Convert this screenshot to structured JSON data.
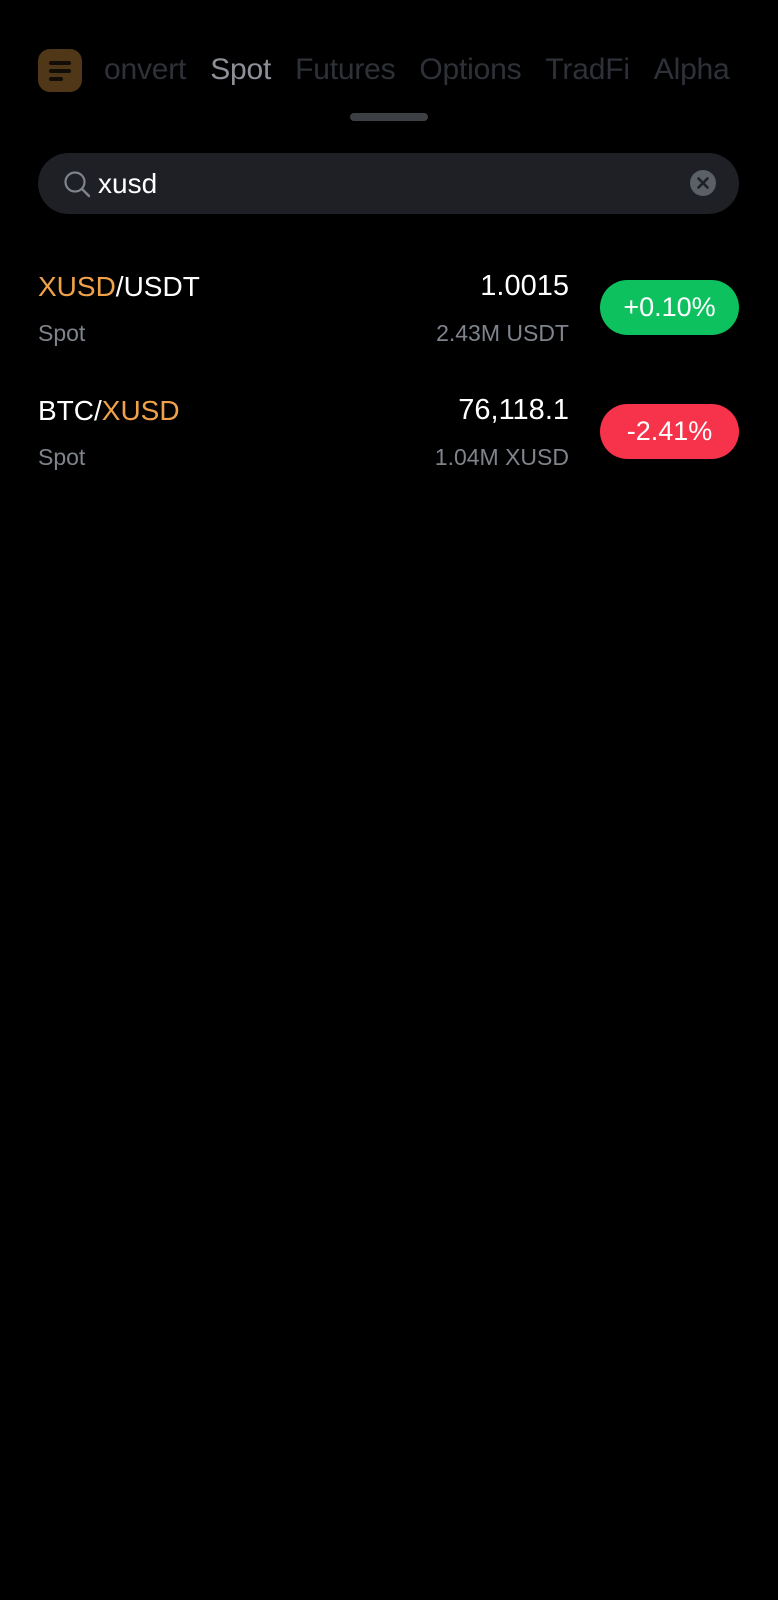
{
  "nav": {
    "tabs": [
      {
        "label": "onvert",
        "active": false
      },
      {
        "label": "Spot",
        "active": true
      },
      {
        "label": "Futures",
        "active": false
      },
      {
        "label": "Options",
        "active": false
      },
      {
        "label": "TradFi",
        "active": false
      },
      {
        "label": "Alpha",
        "active": false
      }
    ],
    "menu_icon": "menu-icon"
  },
  "search": {
    "value": "xusd",
    "icon": "search-icon",
    "clear_icon": "clear-icon"
  },
  "results": [
    {
      "base": "XUSD",
      "separator": "/",
      "quote": "USDT",
      "highlight": "base",
      "market": "Spot",
      "price": "1.0015",
      "volume": "2.43M USDT",
      "change": "+0.10%",
      "direction": "up"
    },
    {
      "base": "BTC",
      "separator": "/",
      "quote": "XUSD",
      "highlight": "quote",
      "market": "Spot",
      "price": "76,118.1",
      "volume": "1.04M XUSD",
      "change": "-2.41%",
      "direction": "down"
    }
  ],
  "colors": {
    "background": "#000000",
    "highlight": "#f0a24a",
    "up": "#0ec15f",
    "down": "#f6334a",
    "search_bg": "#1e2025",
    "muted_text": "#7f848b"
  }
}
